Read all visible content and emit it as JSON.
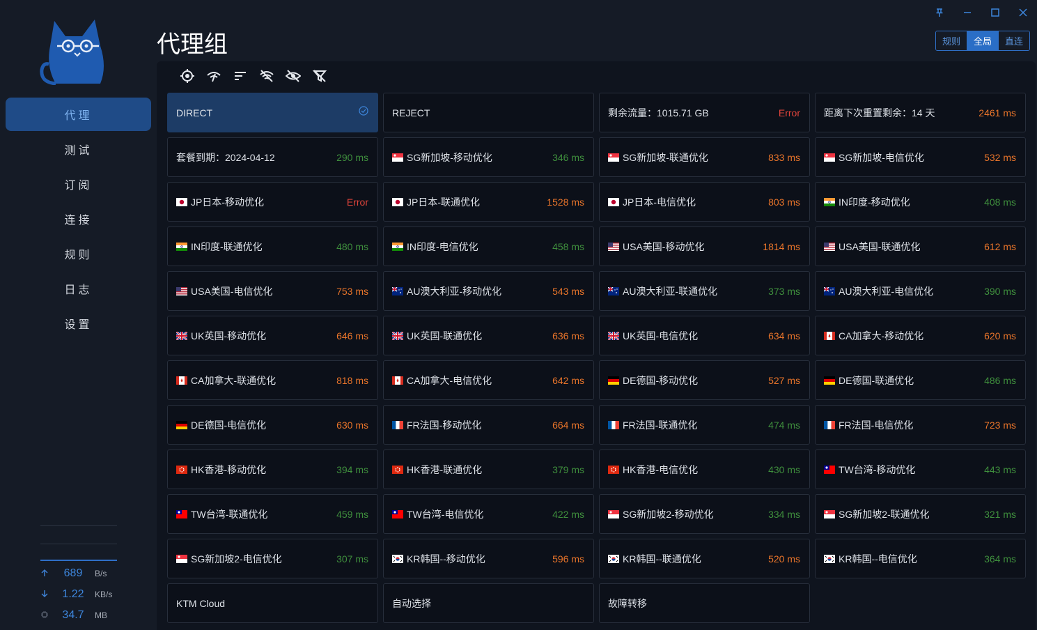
{
  "nav": {
    "items": [
      {
        "label": "代理",
        "active": true
      },
      {
        "label": "测试",
        "active": false
      },
      {
        "label": "订阅",
        "active": false
      },
      {
        "label": "连接",
        "active": false
      },
      {
        "label": "规则",
        "active": false
      },
      {
        "label": "日志",
        "active": false
      },
      {
        "label": "设置",
        "active": false
      }
    ]
  },
  "traffic": {
    "upload": {
      "value": "689",
      "unit": "B/s",
      "icon": "arrow-up-icon"
    },
    "download": {
      "value": "1.22",
      "unit": "KB/s",
      "icon": "arrow-down-icon"
    },
    "memory": {
      "value": "34.7",
      "unit": "MB",
      "icon": "memory-chip-icon"
    }
  },
  "page": {
    "title": "代理组"
  },
  "modes": {
    "items": [
      "规则",
      "全局",
      "直连"
    ],
    "active": "全局"
  },
  "window": {
    "controls": [
      "pin-icon",
      "minimize-icon",
      "maximize-icon",
      "close-icon"
    ]
  },
  "toolbar": {
    "icons": [
      "locate-icon",
      "speed-test-icon",
      "sort-icon",
      "hide-unavailable-icon",
      "hide-icon",
      "filter-off-icon"
    ]
  },
  "colors": {
    "accent": "#2a6ec6",
    "selected_card": "#1d3c66",
    "delay_good": "#3f8f3d",
    "delay_medium": "#e8742a",
    "delay_error": "#e0443b"
  },
  "proxies": [
    {
      "name": "DIRECT",
      "delay": "",
      "flag": "",
      "status": "selected"
    },
    {
      "name": "REJECT",
      "delay": "",
      "flag": "",
      "status": "none"
    },
    {
      "name": "剩余流量：1015.71 GB",
      "delay": "Error",
      "flag": "",
      "status": "error"
    },
    {
      "name": "距离下次重置剩余：14 天",
      "delay": "2461 ms",
      "flag": "",
      "status": "medium"
    },
    {
      "name": "套餐到期：2024-04-12",
      "delay": "290 ms",
      "flag": "",
      "status": "good"
    },
    {
      "name": "SG新加坡-移动优化",
      "delay": "346 ms",
      "flag": "sg",
      "status": "good"
    },
    {
      "name": "SG新加坡-联通优化",
      "delay": "833 ms",
      "flag": "sg",
      "status": "medium"
    },
    {
      "name": "SG新加坡-电信优化",
      "delay": "532 ms",
      "flag": "sg",
      "status": "medium"
    },
    {
      "name": "JP日本-移动优化",
      "delay": "Error",
      "flag": "jp",
      "status": "error"
    },
    {
      "name": "JP日本-联通优化",
      "delay": "1528 ms",
      "flag": "jp",
      "status": "medium"
    },
    {
      "name": "JP日本-电信优化",
      "delay": "803 ms",
      "flag": "jp",
      "status": "medium"
    },
    {
      "name": "IN印度-移动优化",
      "delay": "408 ms",
      "flag": "in",
      "status": "good"
    },
    {
      "name": "IN印度-联通优化",
      "delay": "480 ms",
      "flag": "in",
      "status": "good"
    },
    {
      "name": "IN印度-电信优化",
      "delay": "458 ms",
      "flag": "in",
      "status": "good"
    },
    {
      "name": "USA美国-移动优化",
      "delay": "1814 ms",
      "flag": "us",
      "status": "medium"
    },
    {
      "name": "USA美国-联通优化",
      "delay": "612 ms",
      "flag": "us",
      "status": "medium"
    },
    {
      "name": "USA美国-电信优化",
      "delay": "753 ms",
      "flag": "us",
      "status": "medium"
    },
    {
      "name": "AU澳大利亚-移动优化",
      "delay": "543 ms",
      "flag": "au",
      "status": "medium"
    },
    {
      "name": "AU澳大利亚-联通优化",
      "delay": "373 ms",
      "flag": "au",
      "status": "good"
    },
    {
      "name": "AU澳大利亚-电信优化",
      "delay": "390 ms",
      "flag": "au",
      "status": "good"
    },
    {
      "name": "UK英国-移动优化",
      "delay": "646 ms",
      "flag": "uk",
      "status": "medium"
    },
    {
      "name": "UK英国-联通优化",
      "delay": "636 ms",
      "flag": "uk",
      "status": "medium"
    },
    {
      "name": "UK英国-电信优化",
      "delay": "634 ms",
      "flag": "uk",
      "status": "medium"
    },
    {
      "name": "CA加拿大-移动优化",
      "delay": "620 ms",
      "flag": "ca",
      "status": "medium"
    },
    {
      "name": "CA加拿大-联通优化",
      "delay": "818 ms",
      "flag": "ca",
      "status": "medium"
    },
    {
      "name": "CA加拿大-电信优化",
      "delay": "642 ms",
      "flag": "ca",
      "status": "medium"
    },
    {
      "name": "DE德国-移动优化",
      "delay": "527 ms",
      "flag": "de",
      "status": "medium"
    },
    {
      "name": "DE德国-联通优化",
      "delay": "486 ms",
      "flag": "de",
      "status": "good"
    },
    {
      "name": "DE德国-电信优化",
      "delay": "630 ms",
      "flag": "de",
      "status": "medium"
    },
    {
      "name": "FR法国-移动优化",
      "delay": "664 ms",
      "flag": "fr",
      "status": "medium"
    },
    {
      "name": "FR法国-联通优化",
      "delay": "474 ms",
      "flag": "fr",
      "status": "good"
    },
    {
      "name": "FR法国-电信优化",
      "delay": "723 ms",
      "flag": "fr",
      "status": "medium"
    },
    {
      "name": "HK香港-移动优化",
      "delay": "394 ms",
      "flag": "hk",
      "status": "good"
    },
    {
      "name": "HK香港-联通优化",
      "delay": "379 ms",
      "flag": "hk",
      "status": "good"
    },
    {
      "name": "HK香港-电信优化",
      "delay": "430 ms",
      "flag": "hk",
      "status": "good"
    },
    {
      "name": "TW台湾-移动优化",
      "delay": "443 ms",
      "flag": "tw",
      "status": "good"
    },
    {
      "name": "TW台湾-联通优化",
      "delay": "459 ms",
      "flag": "tw",
      "status": "good"
    },
    {
      "name": "TW台湾-电信优化",
      "delay": "422 ms",
      "flag": "tw",
      "status": "good"
    },
    {
      "name": "SG新加坡2-移动优化",
      "delay": "334 ms",
      "flag": "sg",
      "status": "good"
    },
    {
      "name": "SG新加坡2-联通优化",
      "delay": "321 ms",
      "flag": "sg",
      "status": "good"
    },
    {
      "name": "SG新加坡2-电信优化",
      "delay": "307 ms",
      "flag": "sg",
      "status": "good"
    },
    {
      "name": "KR韩国--移动优化",
      "delay": "596 ms",
      "flag": "kr",
      "status": "medium"
    },
    {
      "name": "KR韩国--联通优化",
      "delay": "520 ms",
      "flag": "kr",
      "status": "medium"
    },
    {
      "name": "KR韩国--电信优化",
      "delay": "364 ms",
      "flag": "kr",
      "status": "good"
    },
    {
      "name": "KTM Cloud",
      "delay": "",
      "flag": "",
      "status": "none"
    },
    {
      "name": "自动选择",
      "delay": "",
      "flag": "",
      "status": "none"
    },
    {
      "name": "故障转移",
      "delay": "",
      "flag": "",
      "status": "none"
    }
  ]
}
